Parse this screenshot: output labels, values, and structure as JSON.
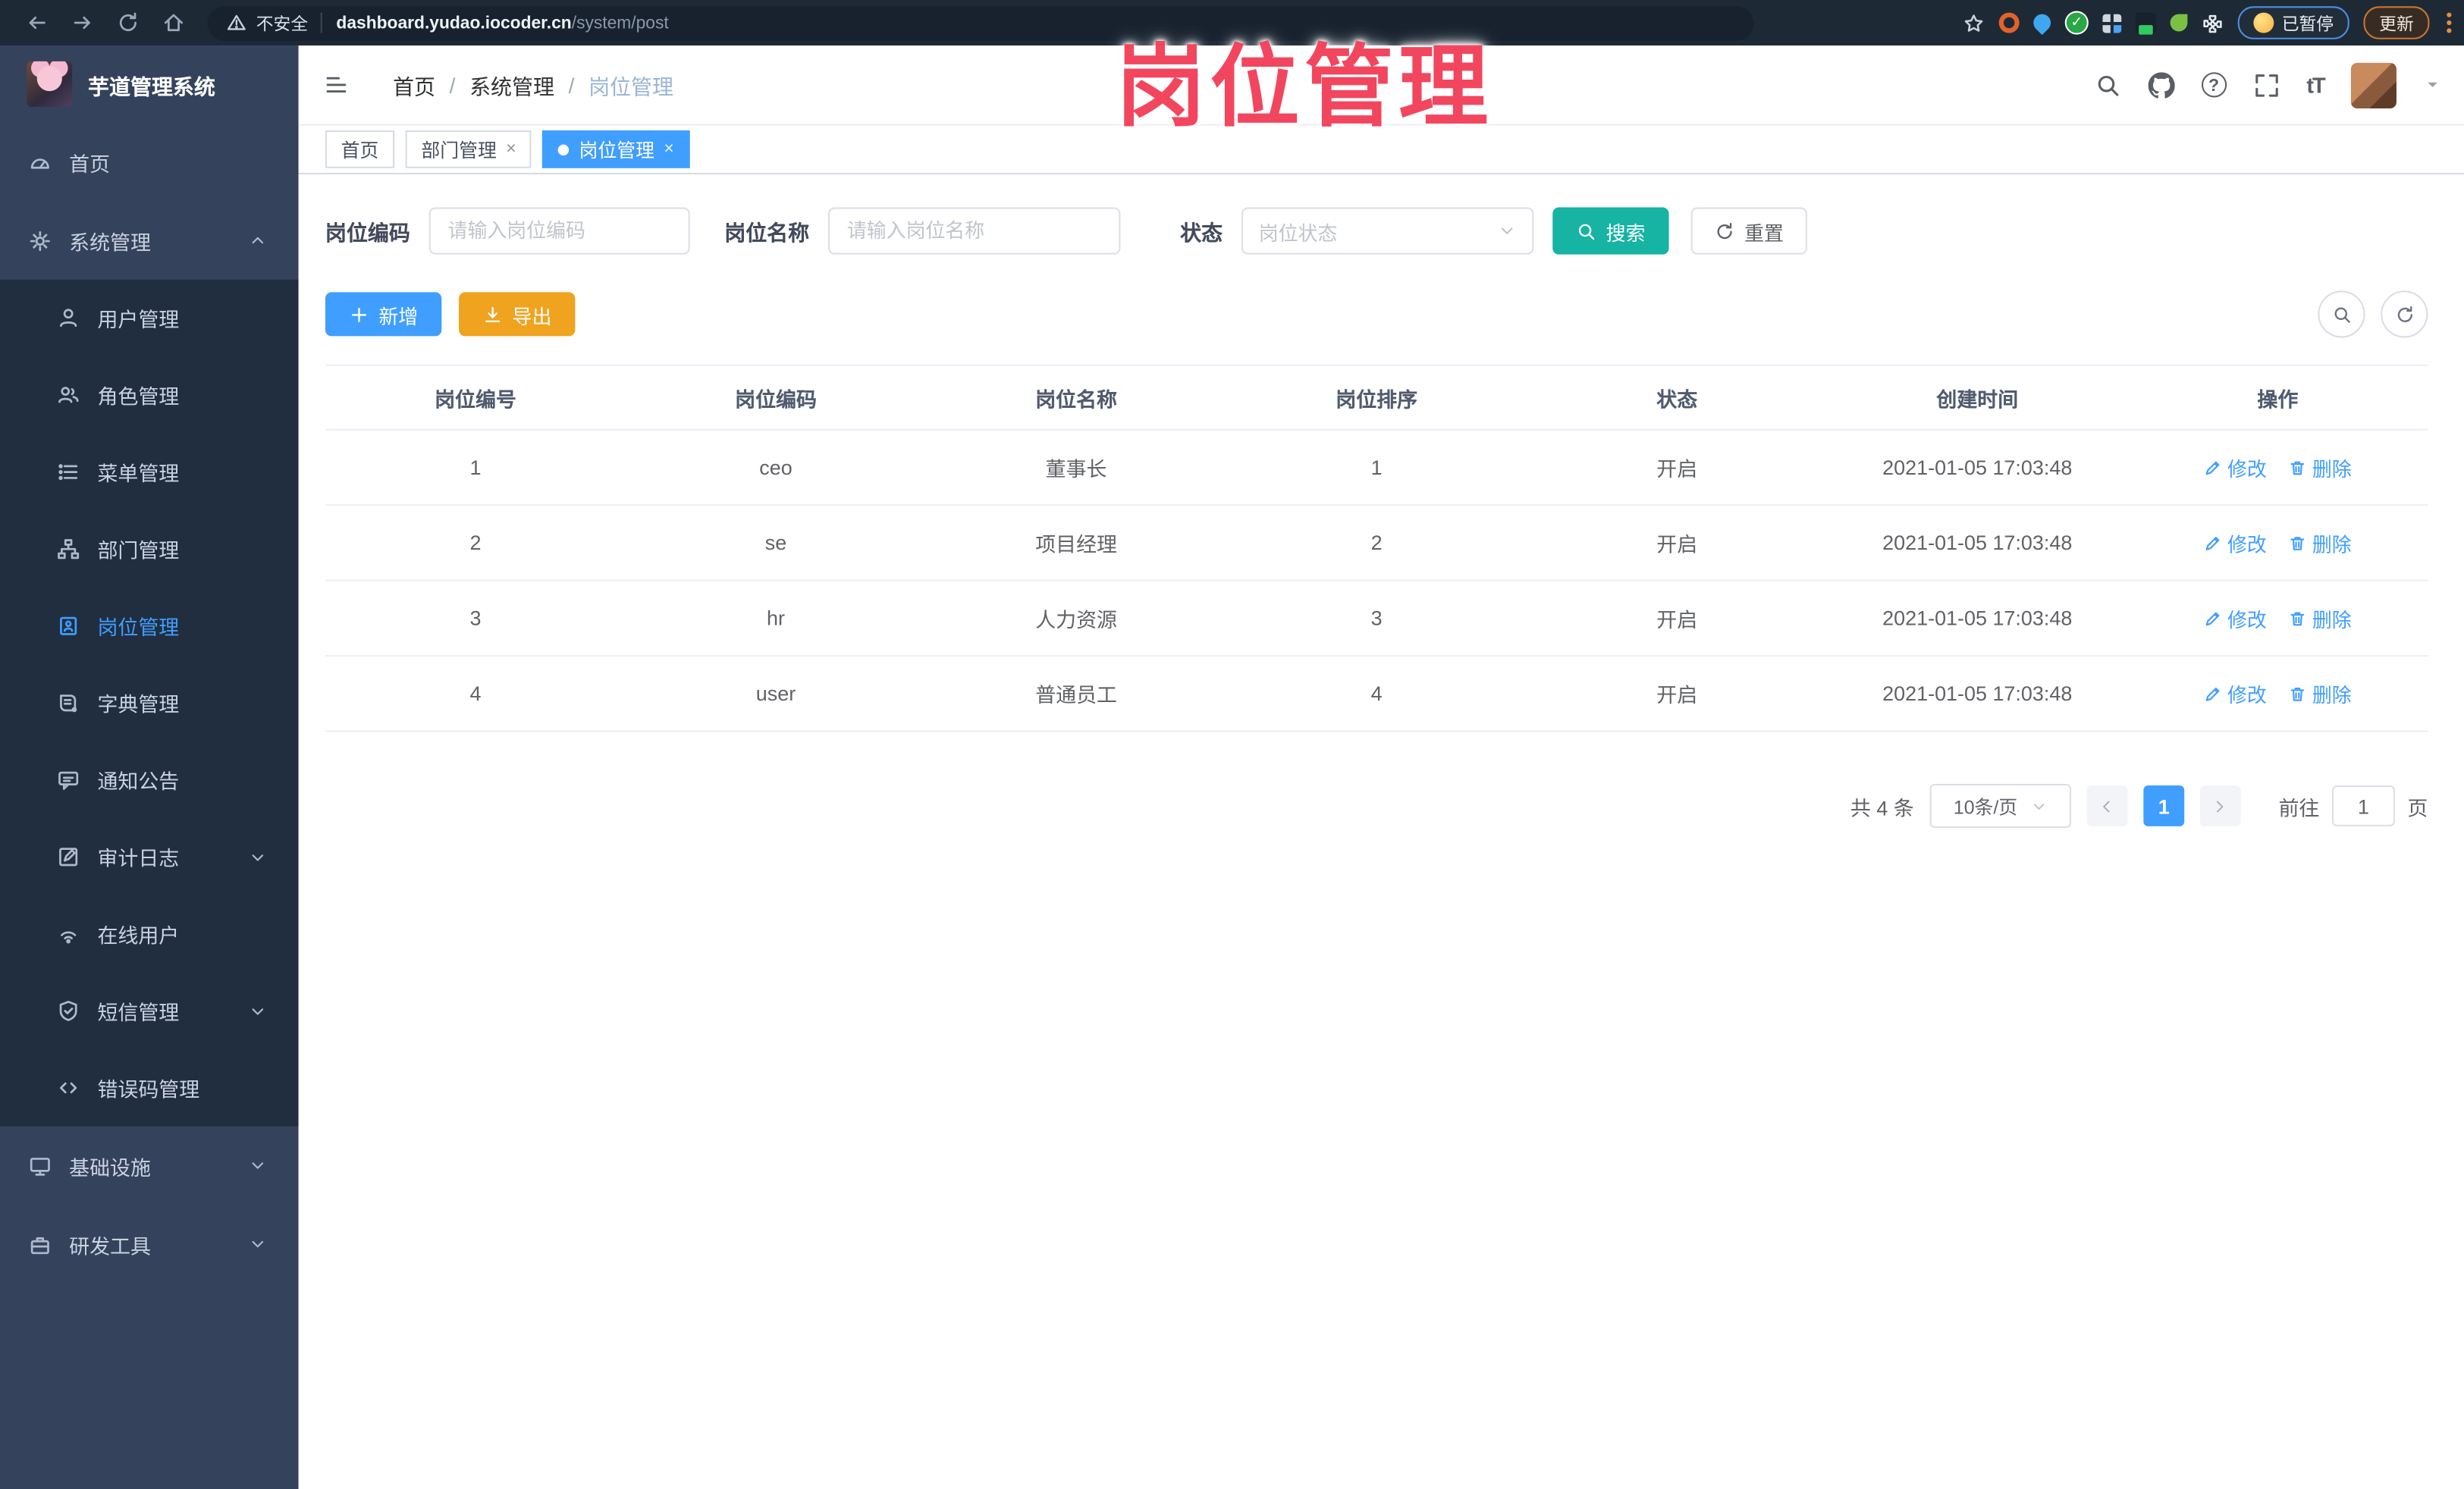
{
  "browser": {
    "security_label": "不安全",
    "url_host": "dashboard.yudao.iocoder.cn",
    "url_path": "/system/post",
    "paused_badge_label": "已暂停",
    "update_button_label": "更新"
  },
  "overlay_title": "岗位管理",
  "sidebar": {
    "app_title": "芋道管理系统",
    "items": [
      {
        "label": "首页"
      },
      {
        "label": "系统管理"
      },
      {
        "label": "用户管理"
      },
      {
        "label": "角色管理"
      },
      {
        "label": "菜单管理"
      },
      {
        "label": "部门管理"
      },
      {
        "label": "岗位管理"
      },
      {
        "label": "字典管理"
      },
      {
        "label": "通知公告"
      },
      {
        "label": "审计日志"
      },
      {
        "label": "在线用户"
      },
      {
        "label": "短信管理"
      },
      {
        "label": "错误码管理"
      },
      {
        "label": "基础设施"
      },
      {
        "label": "研发工具"
      }
    ]
  },
  "header": {
    "breadcrumb": [
      "首页",
      "系统管理",
      "岗位管理"
    ]
  },
  "tabs": [
    {
      "label": "首页"
    },
    {
      "label": "部门管理"
    },
    {
      "label": "岗位管理"
    }
  ],
  "filters": {
    "code_label": "岗位编码",
    "code_placeholder": "请输入岗位编码",
    "name_label": "岗位名称",
    "name_placeholder": "请输入岗位名称",
    "status_label": "状态",
    "status_placeholder": "岗位状态",
    "search_label": "搜索",
    "reset_label": "重置"
  },
  "toolbar": {
    "add_label": "新增",
    "export_label": "导出"
  },
  "table": {
    "columns": [
      "岗位编号",
      "岗位编码",
      "岗位名称",
      "岗位排序",
      "状态",
      "创建时间",
      "操作"
    ],
    "edit_label": "修改",
    "delete_label": "删除",
    "rows": [
      {
        "id": "1",
        "code": "ceo",
        "name": "董事长",
        "sort": "1",
        "status": "开启",
        "created": "2021-01-05 17:03:48"
      },
      {
        "id": "2",
        "code": "se",
        "name": "项目经理",
        "sort": "2",
        "status": "开启",
        "created": "2021-01-05 17:03:48"
      },
      {
        "id": "3",
        "code": "hr",
        "name": "人力资源",
        "sort": "3",
        "status": "开启",
        "created": "2021-01-05 17:03:48"
      },
      {
        "id": "4",
        "code": "user",
        "name": "普通员工",
        "sort": "4",
        "status": "开启",
        "created": "2021-01-05 17:03:48"
      }
    ]
  },
  "pagination": {
    "total_label": "共 4 条",
    "page_size_label": "10条/页",
    "current_page": "1",
    "goto_label": "前往",
    "goto_value": "1",
    "page_unit_label": "页"
  },
  "colors": {
    "accent": "#409eff",
    "search_button": "#17b3a3",
    "export_button": "#f0a31f",
    "overlay_pink": "#f2465f",
    "sidebar_bg": "#35425c",
    "submenu_bg": "#212e3f"
  }
}
